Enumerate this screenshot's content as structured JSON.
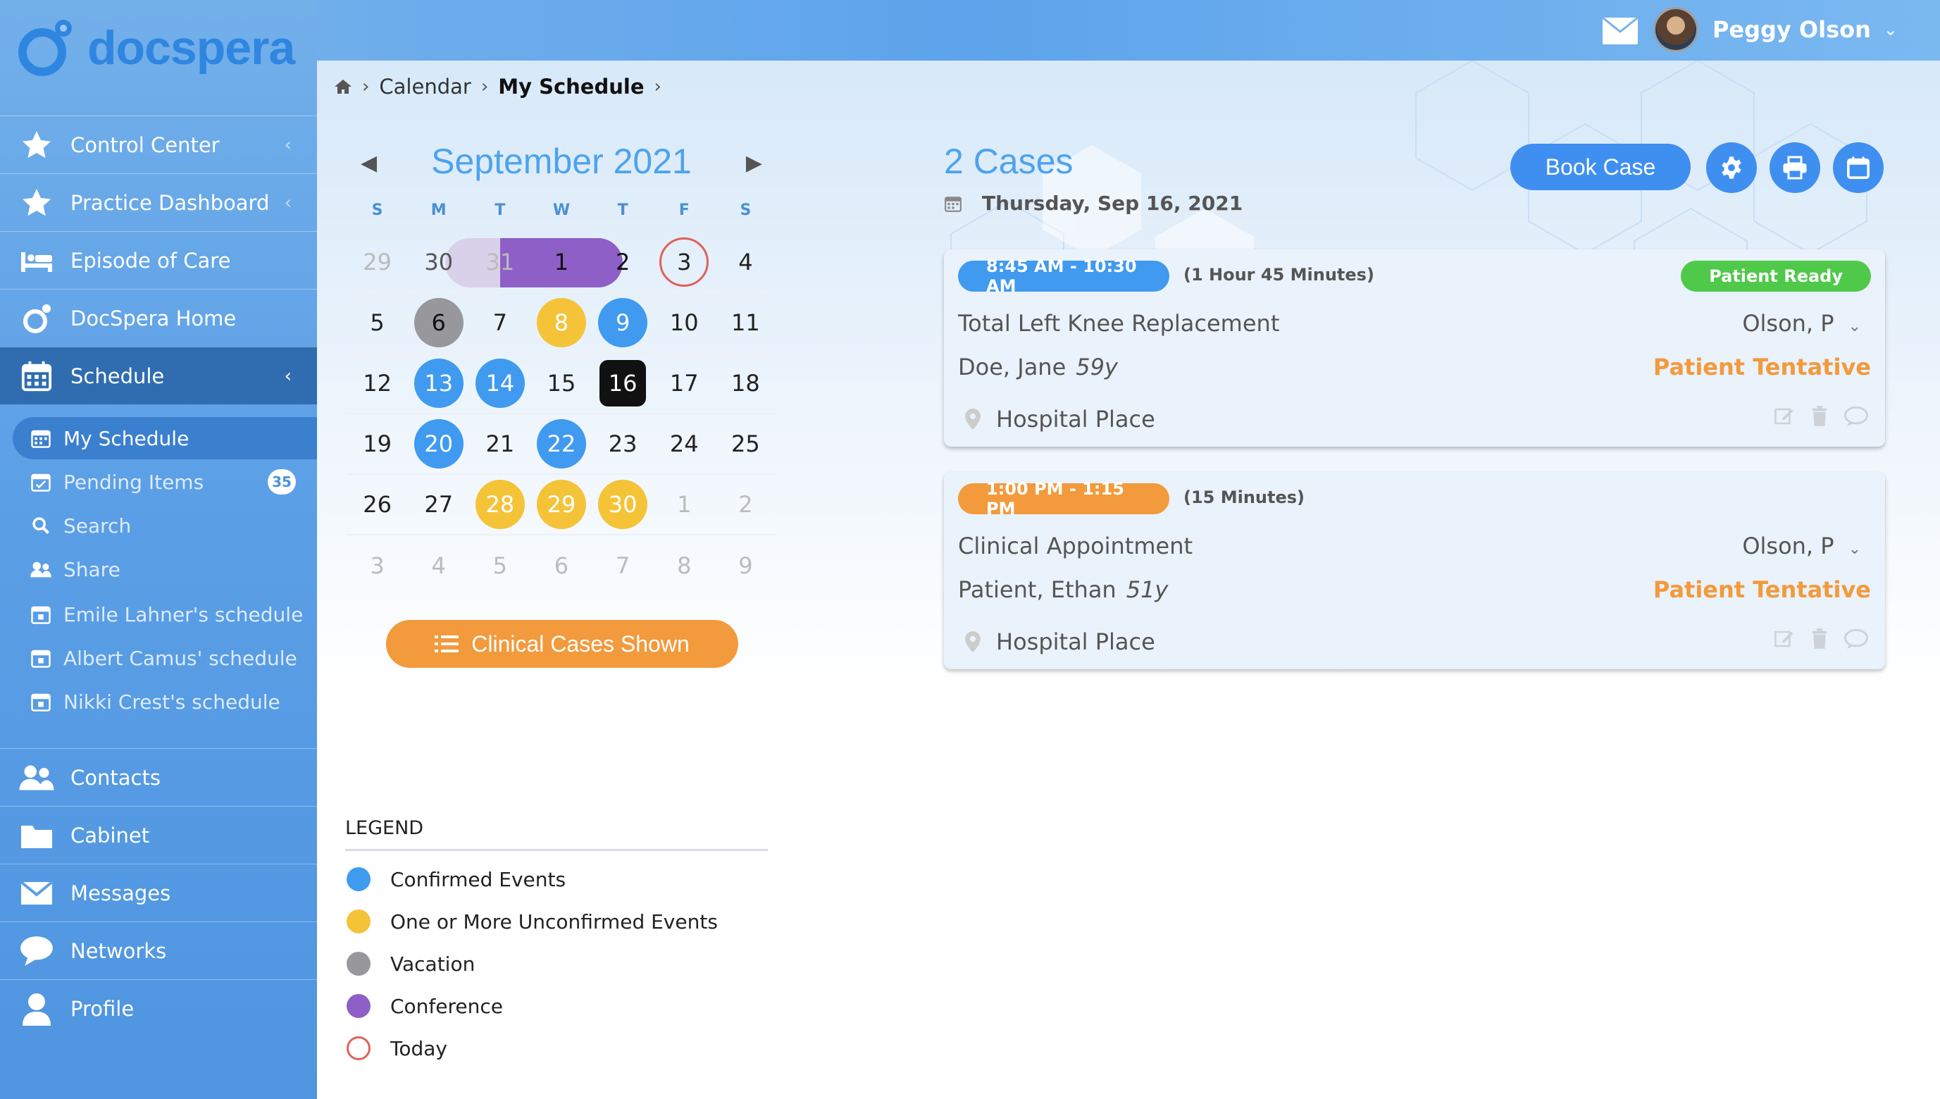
{
  "brand": {
    "name": "docspera"
  },
  "user": {
    "name": "Peggy Olson"
  },
  "breadcrumb": {
    "items": [
      "Calendar",
      "My Schedule"
    ]
  },
  "sidebar": {
    "items": [
      {
        "label": "Control Center",
        "icon": "star-icon"
      },
      {
        "label": "Practice Dashboard",
        "icon": "star-icon"
      },
      {
        "label": "Episode of Care",
        "icon": "bed-icon"
      },
      {
        "label": "DocSpera Home",
        "icon": "docspera-icon"
      },
      {
        "label": "Schedule",
        "icon": "calendar-icon",
        "active": true
      },
      {
        "label": "Contacts",
        "icon": "contacts-icon"
      },
      {
        "label": "Cabinet",
        "icon": "folder-icon"
      },
      {
        "label": "Messages",
        "icon": "mail-icon"
      },
      {
        "label": "Networks",
        "icon": "chat-icon"
      },
      {
        "label": "Profile",
        "icon": "person-icon"
      }
    ],
    "schedule_sub": [
      {
        "label": "My Schedule",
        "icon": "calendar-icon",
        "active": true
      },
      {
        "label": "Pending Items",
        "icon": "pending-icon",
        "badge": "35"
      },
      {
        "label": "Search",
        "icon": "search-icon"
      },
      {
        "label": "Share",
        "icon": "share-icon"
      },
      {
        "label": "Emile Lahner's schedule",
        "icon": "calendar-icon"
      },
      {
        "label": "Albert Camus' schedule",
        "icon": "calendar-icon"
      },
      {
        "label": "Nikki Crest's schedule",
        "icon": "calendar-icon"
      }
    ]
  },
  "calendar": {
    "month_title": "September 2021",
    "prev": "◀",
    "next": "▶",
    "weekdays": [
      "S",
      "M",
      "T",
      "W",
      "T",
      "F",
      "S"
    ],
    "weeks": [
      [
        {
          "d": "29",
          "s": "other"
        },
        {
          "d": "30",
          "s": "other-dark"
        },
        {
          "d": "31",
          "s": "other"
        },
        {
          "d": "1",
          "s": ""
        },
        {
          "d": "2",
          "s": ""
        },
        {
          "d": "3",
          "s": "today"
        },
        {
          "d": "4",
          "s": ""
        }
      ],
      [
        {
          "d": "5",
          "s": ""
        },
        {
          "d": "6",
          "s": "gray"
        },
        {
          "d": "7",
          "s": ""
        },
        {
          "d": "8",
          "s": "yellow"
        },
        {
          "d": "9",
          "s": "blue"
        },
        {
          "d": "10",
          "s": ""
        },
        {
          "d": "11",
          "s": ""
        }
      ],
      [
        {
          "d": "12",
          "s": ""
        },
        {
          "d": "13",
          "s": "blue"
        },
        {
          "d": "14",
          "s": "blue"
        },
        {
          "d": "15",
          "s": ""
        },
        {
          "d": "16",
          "s": "black"
        },
        {
          "d": "17",
          "s": ""
        },
        {
          "d": "18",
          "s": ""
        }
      ],
      [
        {
          "d": "19",
          "s": ""
        },
        {
          "d": "20",
          "s": "blue"
        },
        {
          "d": "21",
          "s": ""
        },
        {
          "d": "22",
          "s": "blue"
        },
        {
          "d": "23",
          "s": ""
        },
        {
          "d": "24",
          "s": ""
        },
        {
          "d": "25",
          "s": ""
        }
      ],
      [
        {
          "d": "26",
          "s": ""
        },
        {
          "d": "27",
          "s": ""
        },
        {
          "d": "28",
          "s": "yellow"
        },
        {
          "d": "29",
          "s": "yellow"
        },
        {
          "d": "30",
          "s": "yellow"
        },
        {
          "d": "1",
          "s": "other"
        },
        {
          "d": "2",
          "s": "other"
        }
      ],
      [
        {
          "d": "3",
          "s": "other"
        },
        {
          "d": "4",
          "s": "other"
        },
        {
          "d": "5",
          "s": "other"
        },
        {
          "d": "6",
          "s": "other"
        },
        {
          "d": "7",
          "s": "other"
        },
        {
          "d": "8",
          "s": "other"
        },
        {
          "d": "9",
          "s": "other"
        }
      ]
    ],
    "filter_button": "Clinical Cases Shown"
  },
  "legend": {
    "title": "LEGEND",
    "items": [
      {
        "label": "Confirmed Events",
        "color": "#3f9af0"
      },
      {
        "label": "One or More Unconfirmed Events",
        "color": "#f5c338"
      },
      {
        "label": "Vacation",
        "color": "#97979c"
      },
      {
        "label": "Conference",
        "color": "#8e5fc6"
      },
      {
        "label": "Today",
        "color": "#e0605a"
      }
    ]
  },
  "cases": {
    "count_label": "2 Cases",
    "date_label": "Thursday, Sep 16, 2021",
    "book_case": "Book Case",
    "list": [
      {
        "time": "8:45 AM - 10:30 AM",
        "duration": "(1 Hour 45 Minutes)",
        "status": "Patient Ready",
        "procedure": "Total Left Knee Replacement",
        "provider": "Olson, P",
        "patient": "Doe, Jane",
        "age": "59y",
        "patient_status": "Patient Tentative",
        "location": "Hospital Place",
        "time_color": "#3f9af0"
      },
      {
        "time": "1:00 PM - 1:15 PM",
        "duration": "(15 Minutes)",
        "status": "",
        "procedure": "Clinical Appointment",
        "provider": "Olson, P",
        "patient": "Patient, Ethan",
        "age": "51y",
        "patient_status": "Patient Tentative",
        "location": "Hospital Place",
        "time_color": "#f29a3c"
      }
    ]
  },
  "colors": {
    "accent": "#3f8ff0",
    "sidebar": "#5b9fe6",
    "orange": "#f29a3c",
    "green": "#4fc94a"
  }
}
